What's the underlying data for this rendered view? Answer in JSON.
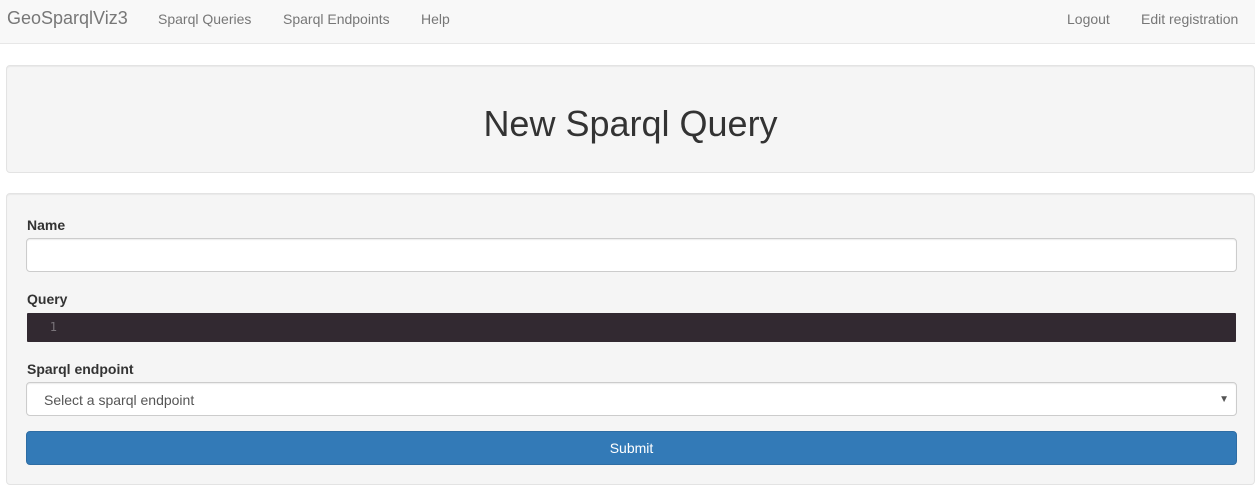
{
  "navbar": {
    "brand": "GeoSparqlViz3",
    "left_links": [
      "Sparql Queries",
      "Sparql Endpoints",
      "Help"
    ],
    "right_links": [
      "Logout",
      "Edit registration"
    ]
  },
  "header": {
    "title": "New Sparql Query"
  },
  "form": {
    "name_label": "Name",
    "name_value": "",
    "query_label": "Query",
    "query_line_number": "1",
    "endpoint_label": "Sparql endpoint",
    "endpoint_selected": "Select a sparql endpoint",
    "submit_label": "Submit"
  },
  "colors": {
    "primary": "#337ab7",
    "editor_background": "#322931",
    "panel_background": "#f5f5f5"
  },
  "icons": {
    "select_caret": "caret-down-icon"
  }
}
